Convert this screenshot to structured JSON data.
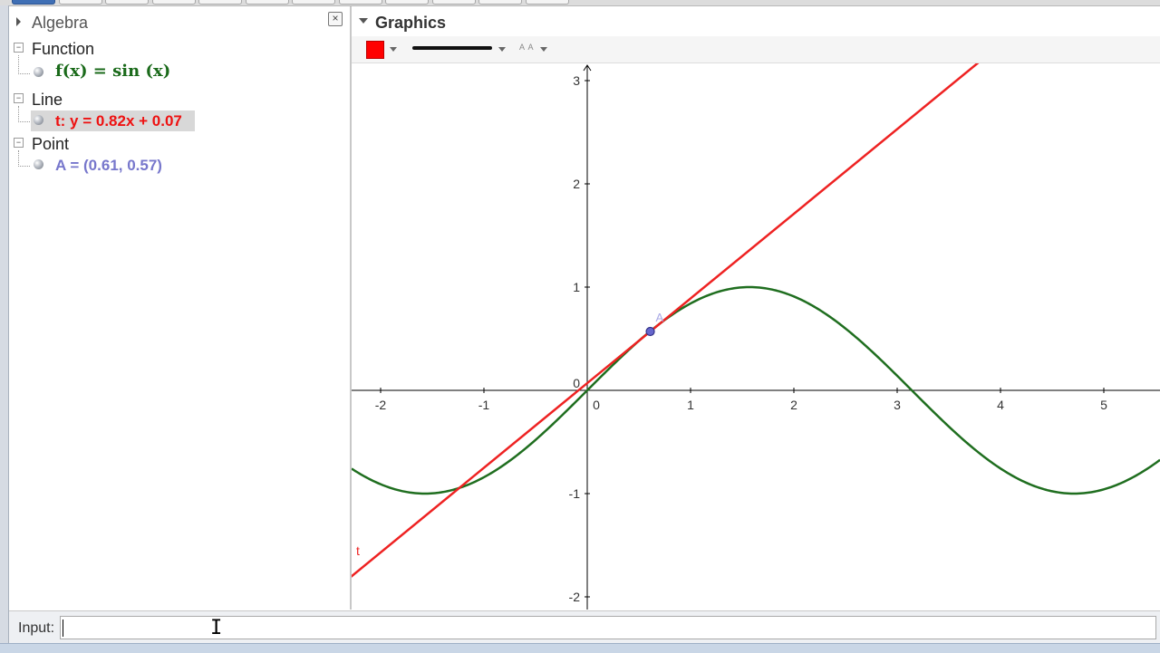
{
  "toolbar": {
    "tool_count": 12
  },
  "algebra": {
    "title": "Algebra",
    "close_glyph": "×",
    "categories": [
      {
        "label": "Function",
        "toggle": "−",
        "object": "f(x)  =  sin (x)"
      },
      {
        "label": "Line",
        "toggle": "−",
        "object": "t: y = 0.82x + 0.07"
      },
      {
        "label": "Point",
        "toggle": "−",
        "object": "A = (0.61, 0.57)"
      }
    ]
  },
  "graphics": {
    "title": "Graphics",
    "style_bar": {
      "color": "#ff0000",
      "text_style": "A A"
    },
    "axes": {
      "x_ticks": [
        "-2",
        "-1",
        "0",
        "1",
        "2",
        "3",
        "4",
        "5"
      ],
      "y_ticks": [
        "3",
        "2",
        "1",
        "0",
        "-1",
        "-2"
      ]
    },
    "objects": {
      "function": {
        "color": "#1f6e1f",
        "expr": "sin(x)"
      },
      "line": {
        "name": "t",
        "color": "#ee2222",
        "slope": 0.82,
        "intercept": 0.07
      },
      "point": {
        "name": "A",
        "color": "#6666cc",
        "x": 0.61,
        "y": 0.57
      }
    }
  },
  "input": {
    "label": "Input:",
    "value": "",
    "placeholder": ""
  },
  "icons": {
    "cursor": "I"
  }
}
